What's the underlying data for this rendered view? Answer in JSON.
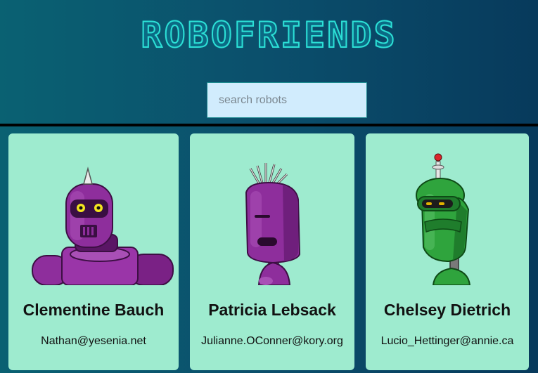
{
  "app": {
    "title": "ROBOFRIENDS"
  },
  "search": {
    "placeholder": "search robots",
    "value": ""
  },
  "robots": [
    {
      "name": "Clementine Bauch",
      "email": "Nathan@yesenia.net",
      "color": "#8e2e9c"
    },
    {
      "name": "Patricia Lebsack",
      "email": "Julianne.OConner@kory.org",
      "color": "#8e2e9c"
    },
    {
      "name": "Chelsey Dietrich",
      "email": "Lucio_Hettinger@annie.ca",
      "color": "#2fa43d"
    }
  ],
  "colors": {
    "card_background": "#9eebcf",
    "search_background": "#d1ecfd",
    "title_outline": "#2ce0d6"
  }
}
